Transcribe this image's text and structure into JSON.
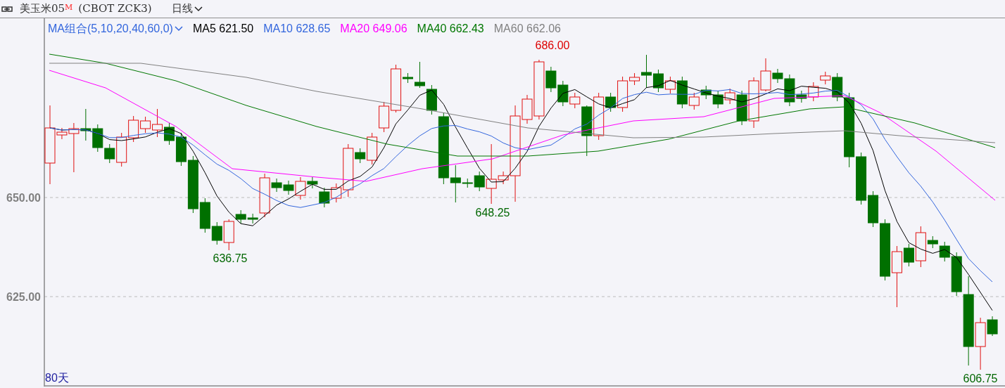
{
  "header": {
    "symbol": "美玉米05",
    "marker": "M",
    "code": "(CBOT ZCK3)",
    "period": "日线"
  },
  "legend": {
    "selector": "MA组合(5,10,20,40,60,0)",
    "items": [
      {
        "label": "MA5",
        "value": "621.50",
        "color": "#000000"
      },
      {
        "label": "MA10",
        "value": "628.65",
        "color": "#3366dd"
      },
      {
        "label": "MA20",
        "value": "649.06",
        "color": "#ff00ff"
      },
      {
        "label": "MA40",
        "value": "662.43",
        "color": "#007700"
      },
      {
        "label": "MA60",
        "value": "662.06",
        "color": "#808080"
      }
    ]
  },
  "y_axis": {
    "labels": [
      "650.00",
      "625.00"
    ]
  },
  "annotations": [
    {
      "text": "686.00",
      "color": "#dd0000"
    },
    {
      "text": "648.25",
      "color": "#006600"
    },
    {
      "text": "636.75",
      "color": "#006600"
    },
    {
      "text": "606.75",
      "color": "#006600"
    }
  ],
  "range_label": "80天"
}
